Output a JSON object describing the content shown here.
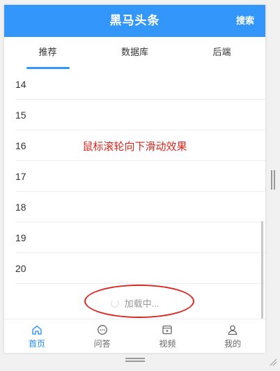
{
  "navbar": {
    "title": "黑马头条",
    "search_label": "搜索"
  },
  "tabs": [
    {
      "label": "推荐",
      "active": true
    },
    {
      "label": "数据库",
      "active": false
    },
    {
      "label": "后端",
      "active": false
    }
  ],
  "list": {
    "items": [
      "14",
      "15",
      "16",
      "17",
      "18",
      "19",
      "20"
    ]
  },
  "annotation": {
    "text": "鼠标滚轮向下滑动效果"
  },
  "loading": {
    "text": "加载中..."
  },
  "tabbar": {
    "items": [
      {
        "label": "首页",
        "icon": "home-icon",
        "active": true
      },
      {
        "label": "问答",
        "icon": "chat-icon",
        "active": false
      },
      {
        "label": "视频",
        "icon": "video-icon",
        "active": false
      },
      {
        "label": "我的",
        "icon": "user-icon",
        "active": false
      }
    ]
  },
  "colors": {
    "brand": "#3296fa",
    "tabbar_active": "#1989fa",
    "annotation": "#d7261e"
  }
}
